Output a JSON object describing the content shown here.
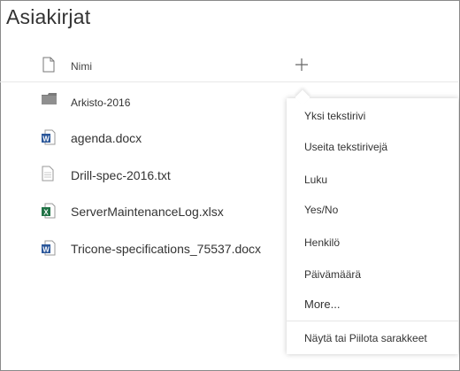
{
  "page": {
    "title": "Asiakirjat"
  },
  "header": {
    "name_label": "Nimi",
    "add_icon": "plus-icon"
  },
  "files": [
    {
      "name": "Arkisto-2016",
      "icon": "folder-icon"
    },
    {
      "name": "agenda.docx",
      "icon": "word-file-icon"
    },
    {
      "name": "Drill-spec-2016.txt",
      "icon": "text-file-icon"
    },
    {
      "name": "ServerMaintenanceLog.xlsx",
      "icon": "excel-file-icon"
    },
    {
      "name": "Tricone-specifications_75537.docx",
      "icon": "word-file-icon"
    }
  ],
  "menu": {
    "items": [
      "Yksi tekstirivi",
      "Useita tekstirivejä",
      "Luku",
      "Yes/No",
      "Henkilö",
      "Päivämäärä",
      "More..."
    ],
    "footer_item": "Näytä tai Piilota sarakkeet"
  },
  "colors": {
    "word": "#2b579a",
    "excel": "#217346",
    "folder": "#8f8f8f",
    "text": "#333333"
  }
}
